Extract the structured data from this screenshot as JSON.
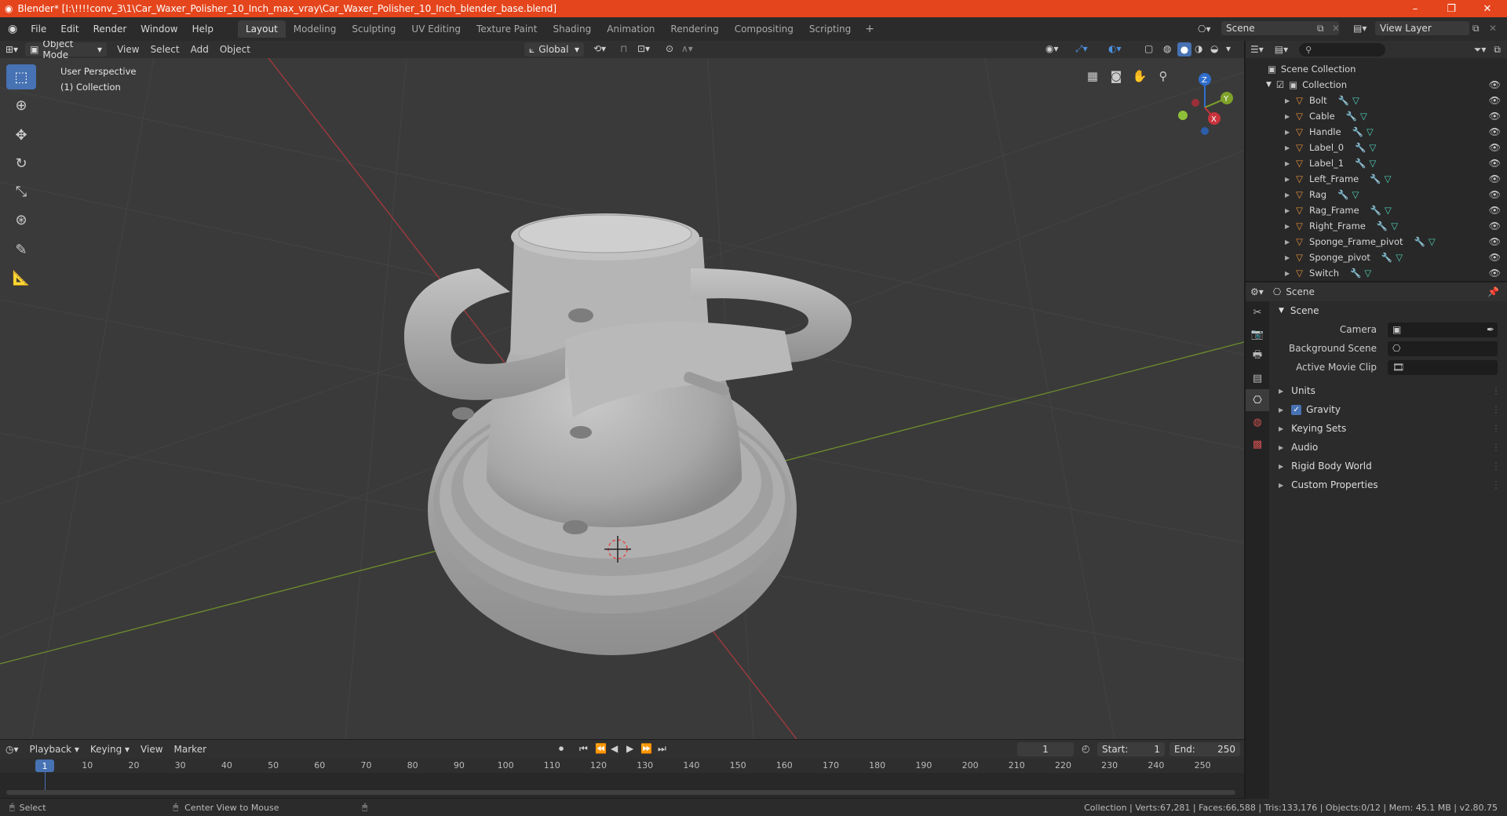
{
  "window": {
    "title": "Blender* [I:\\!!!!conv_3\\1\\Car_Waxer_Polisher_10_Inch_max_vray\\Car_Waxer_Polisher_10_Inch_blender_base.blend]",
    "minimize": "–",
    "maximize": "❐",
    "close": "✕"
  },
  "menu": [
    "File",
    "Edit",
    "Render",
    "Window",
    "Help"
  ],
  "workspaces": [
    "Layout",
    "Modeling",
    "Sculpting",
    "UV Editing",
    "Texture Paint",
    "Shading",
    "Animation",
    "Rendering",
    "Compositing",
    "Scripting"
  ],
  "active_workspace": "Layout",
  "scene_selector": "Scene",
  "view_layer": "View Layer",
  "viewport_header": {
    "mode": "Object Mode",
    "menus": [
      "View",
      "Select",
      "Add",
      "Object"
    ],
    "transform_orientation": "Global"
  },
  "viewport": {
    "perspective_label": "User Perspective",
    "collection_label": "(1) Collection",
    "gizmo_axes": [
      "Z",
      "Y",
      "X"
    ],
    "colors": {
      "x_axis": "#c8343c",
      "y_axis": "#7ea22a",
      "z_axis": "#2f6ecc"
    }
  },
  "outliner": {
    "root": "Scene Collection",
    "collection": "Collection",
    "objects": [
      "Bolt",
      "Cable",
      "Handle",
      "Label_0",
      "Label_1",
      "Left_Frame",
      "Rag",
      "Rag_Frame",
      "Right_Frame",
      "Sponge_Frame_pivot",
      "Sponge_pivot",
      "Switch"
    ]
  },
  "properties": {
    "context": "Scene",
    "section": "Scene",
    "fields": [
      {
        "label": "Camera"
      },
      {
        "label": "Background Scene"
      },
      {
        "label": "Active Movie Clip"
      }
    ],
    "panels": [
      "Units",
      "Gravity",
      "Keying Sets",
      "Audio",
      "Rigid Body World",
      "Custom Properties"
    ],
    "gravity_checked": true
  },
  "timeline": {
    "menus": [
      "Playback",
      "Keying",
      "View",
      "Marker"
    ],
    "current_frame": "1",
    "start_label": "Start:",
    "start": "1",
    "end_label": "End:",
    "end": "250",
    "ticks": [
      "10",
      "20",
      "30",
      "40",
      "50",
      "60",
      "70",
      "80",
      "90",
      "100",
      "110",
      "120",
      "130",
      "140",
      "150",
      "160",
      "170",
      "180",
      "190",
      "200",
      "210",
      "220",
      "230",
      "240",
      "250"
    ],
    "playhead": "1"
  },
  "status": {
    "left_action": "Select",
    "mid_action": "Center View to Mouse",
    "stats": "Collection | Verts:67,281 | Faces:66,588 | Tris:133,176 | Objects:0/12 | Mem: 45.1 MB | v2.80.75"
  },
  "colors": {
    "title_bar": "#e5451c",
    "active_blue": "#4772b3",
    "object_orange": "#e8913a",
    "mesh_teal": "#4fd1b7"
  }
}
